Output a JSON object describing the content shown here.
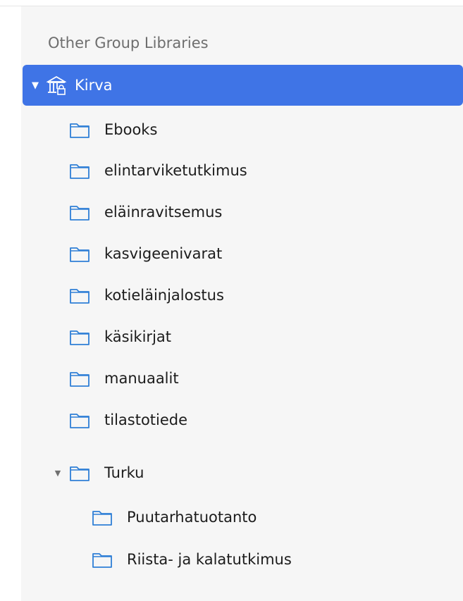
{
  "sidebar": {
    "section_header": "Other Group Libraries",
    "library": {
      "label": "Kirva",
      "expanded": true,
      "selected": true,
      "icon": "library-icon"
    },
    "collections": [
      {
        "label": "Ebooks",
        "icon": "folder-icon"
      },
      {
        "label": "elintarviketutkimus",
        "icon": "folder-icon"
      },
      {
        "label": "eläinravitsemus",
        "icon": "folder-icon"
      },
      {
        "label": "kasvigeenivarat",
        "icon": "folder-icon"
      },
      {
        "label": "kotieläinjalostus",
        "icon": "folder-icon"
      },
      {
        "label": "käsikirjat",
        "icon": "folder-icon"
      },
      {
        "label": "manuaalit",
        "icon": "folder-icon"
      },
      {
        "label": "tilastotiede",
        "icon": "folder-icon"
      },
      {
        "label": "Turku",
        "icon": "folder-icon",
        "expanded": true
      }
    ],
    "subcollections": [
      {
        "label": "Puutarhatuotanto",
        "icon": "folder-icon"
      },
      {
        "label": "Riista- ja kalatutkimus",
        "icon": "folder-icon"
      }
    ]
  },
  "colors": {
    "selection": "#3f74e6",
    "folder_stroke": "#2f7fd6",
    "header_text": "#6e6e6e",
    "item_text": "#1c1c1c"
  }
}
